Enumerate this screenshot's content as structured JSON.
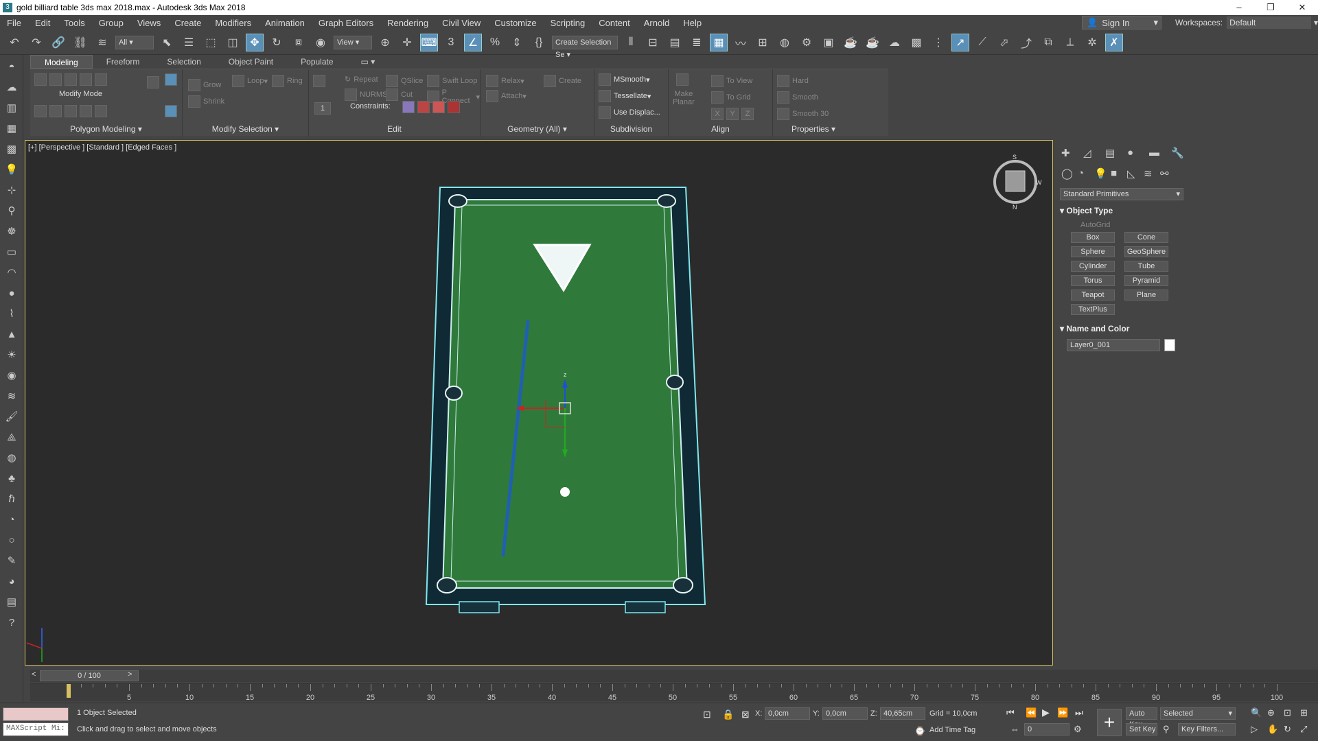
{
  "window": {
    "title": "gold billiard table 3ds max 2018.max - Autodesk 3ds Max 2018",
    "minimize": "–",
    "restore": "❐",
    "close": "✕"
  },
  "menu": [
    "File",
    "Edit",
    "Tools",
    "Group",
    "Views",
    "Create",
    "Modifiers",
    "Animation",
    "Graph Editors",
    "Rendering",
    "Civil View",
    "Customize",
    "Scripting",
    "Content",
    "Arnold",
    "Help"
  ],
  "account": {
    "sign_in": "Sign In",
    "workspaces_label": "Workspaces:",
    "workspace": "Default"
  },
  "toolbar": {
    "filter": "All",
    "ref_coord": "View",
    "selection_set": "Create Selection Se"
  },
  "ribbon": {
    "tabs": [
      "Modeling",
      "Freeform",
      "Selection",
      "Object Paint",
      "Populate"
    ],
    "groups": {
      "polygon_modeling": "Polygon Modeling",
      "modify_selection": "Modify Selection",
      "edit": "Edit",
      "geometry": "Geometry (All)",
      "subdivision": "Subdivision",
      "align": "Align",
      "properties": "Properties"
    },
    "modify_mode": "Modify Mode",
    "grow": "Grow",
    "shrink": "Shrink",
    "loop": "Loop",
    "ring": "Ring",
    "repeat": "Repeat",
    "qslice": "QSlice",
    "swift_loop": "Swift Loop",
    "nurms": "NURMS",
    "cut": "Cut",
    "p_connect": "P Connect",
    "constraints": "Constraints:",
    "spinner_value": "1",
    "relax": "Relax",
    "create": "Create",
    "attach": "Attach",
    "msmooth": "MSmooth",
    "tessellate": "Tessellate",
    "use_displace": "Use Displac...",
    "make": "Make",
    "planar": "Planar",
    "to_view": "To View",
    "to_grid": "To Grid",
    "x": "X",
    "y": "Y",
    "z": "Z",
    "hard": "Hard",
    "smooth": "Smooth",
    "smooth30": "Smooth 30"
  },
  "viewport": {
    "label": "[+] [Perspective ] [Standard ] [Edged Faces ]",
    "gizmo_axis_z": "z",
    "viewcube": {
      "n": "N",
      "s": "S",
      "w": "W"
    }
  },
  "command_panel": {
    "dropdown": "Standard Primitives",
    "object_type": "Object Type",
    "autogrid": "AutoGrid",
    "primitives": [
      "Box",
      "Cone",
      "Sphere",
      "GeoSphere",
      "Cylinder",
      "Tube",
      "Torus",
      "Pyramid",
      "Teapot",
      "Plane",
      "TextPlus"
    ],
    "name_and_color": "Name and Color",
    "object_name": "Layer0_001",
    "object_color": "#ffffff"
  },
  "timeline": {
    "frame": "0 / 100",
    "prev": "<",
    "next": ">",
    "ticks": [
      "5",
      "10",
      "15",
      "20",
      "25",
      "30",
      "35",
      "40",
      "45",
      "50",
      "55",
      "60",
      "65",
      "70",
      "75",
      "80",
      "85",
      "90",
      "95",
      "100"
    ]
  },
  "status": {
    "maxscript": "MAXScript Mi:",
    "selected": "1 Object Selected",
    "prompt": "Click and drag to select and move objects",
    "x_label": "X:",
    "x": "0,0cm",
    "y_label": "Y:",
    "y": "0,0cm",
    "z_label": "Z:",
    "z": "40,65cm",
    "grid": "Grid = 10,0cm",
    "add_time_tag": "Add Time Tag",
    "auto_key": "Auto Key",
    "set_key": "Set Key",
    "key_mode": "Selected",
    "key_filters": "Key Filters...",
    "frame_field": "0"
  },
  "colors": {
    "felt": "#2f7a3a",
    "rail": "#0f2a35",
    "selection": "#7fe8ee",
    "cue": "#2060b0",
    "viewport_border": "#d8c060"
  }
}
